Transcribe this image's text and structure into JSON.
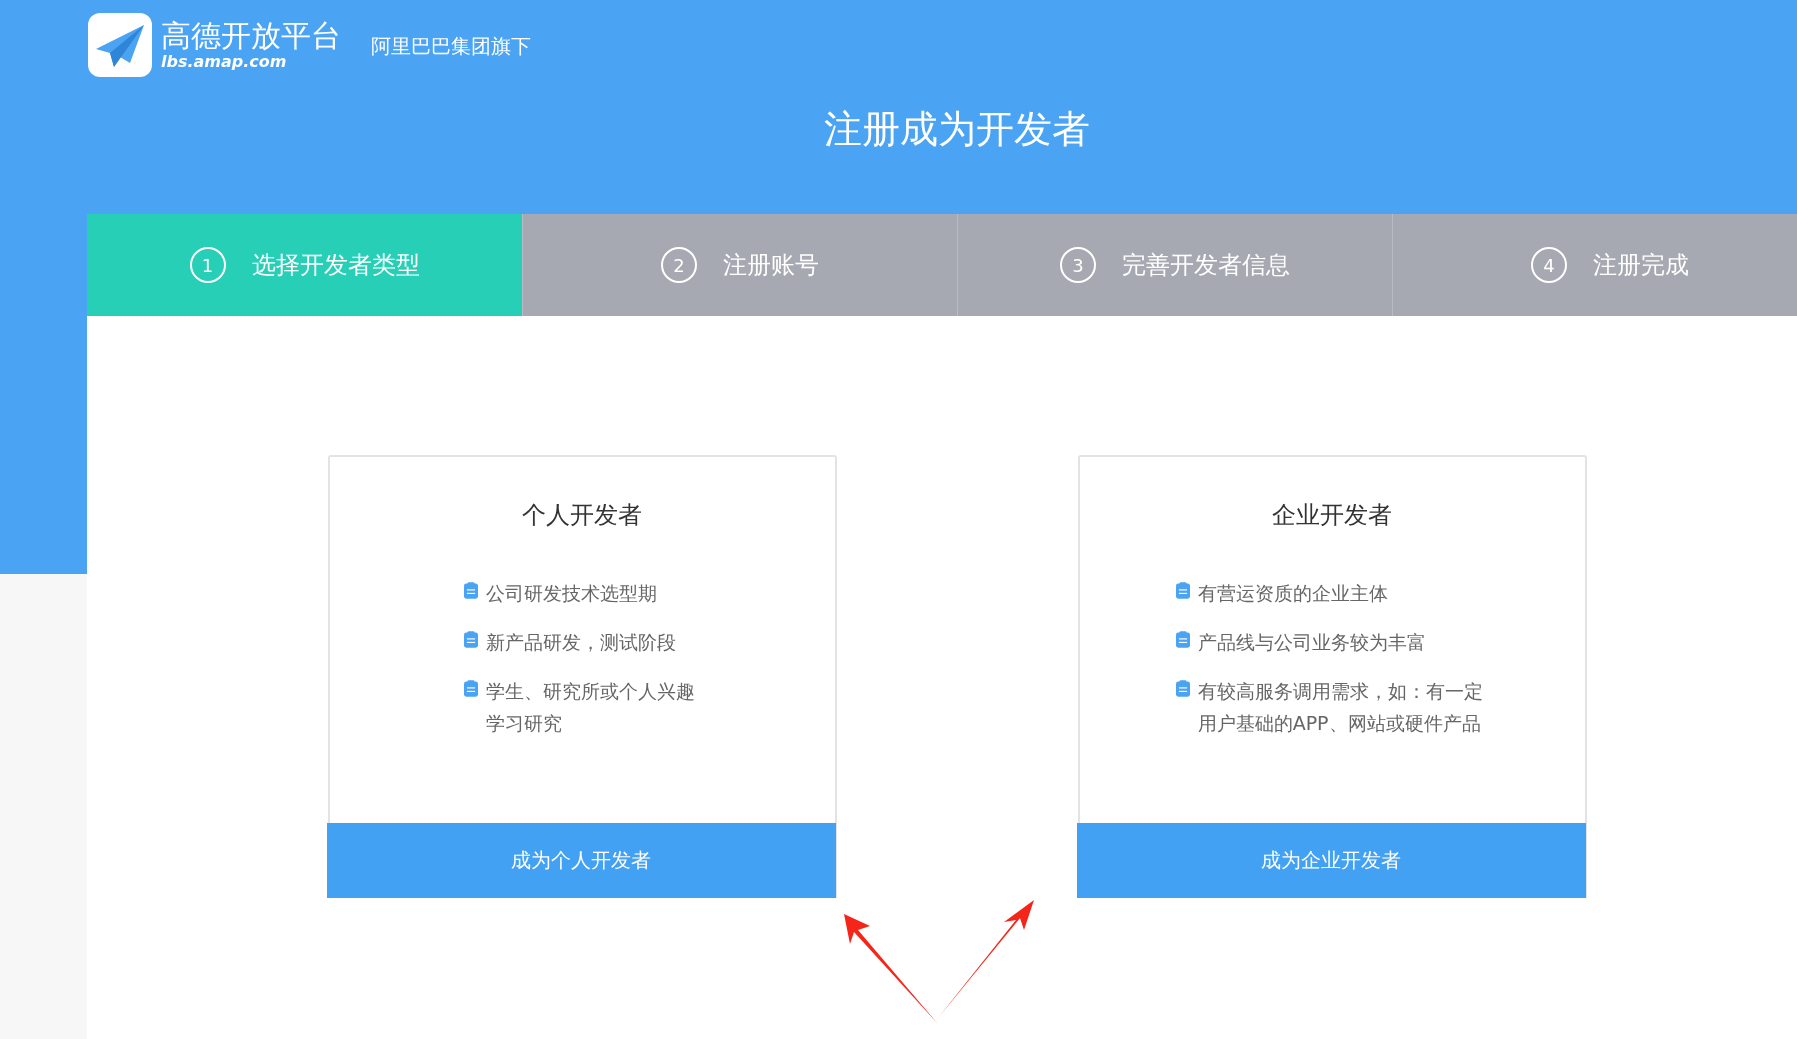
{
  "header": {
    "brand": "高德开放平台",
    "domain": "lbs.amap.com",
    "tagline": "阿里巴巴集团旗下",
    "title": "注册成为开发者"
  },
  "steps": [
    {
      "number": "1",
      "label": "选择开发者类型",
      "selected": true
    },
    {
      "number": "2",
      "label": "注册账号",
      "selected": false
    },
    {
      "number": "3",
      "label": "完善开发者信息",
      "selected": false
    },
    {
      "number": "4",
      "label": "注册完成",
      "selected": false
    }
  ],
  "cards": [
    {
      "title": "个人开发者",
      "items": [
        "公司研发技术选型期",
        "新产品研发，测试阶段",
        "学生、研究所或个人兴趣学习研究"
      ],
      "button": "成为个人开发者"
    },
    {
      "title": "企业开发者",
      "items": [
        "有营运资质的企业主体",
        "产品线与公司业务较为丰富",
        "有较高服务调用需求，如：有一定用户基础的APP、网站或硬件产品"
      ],
      "button": "成为企业开发者"
    }
  ]
}
